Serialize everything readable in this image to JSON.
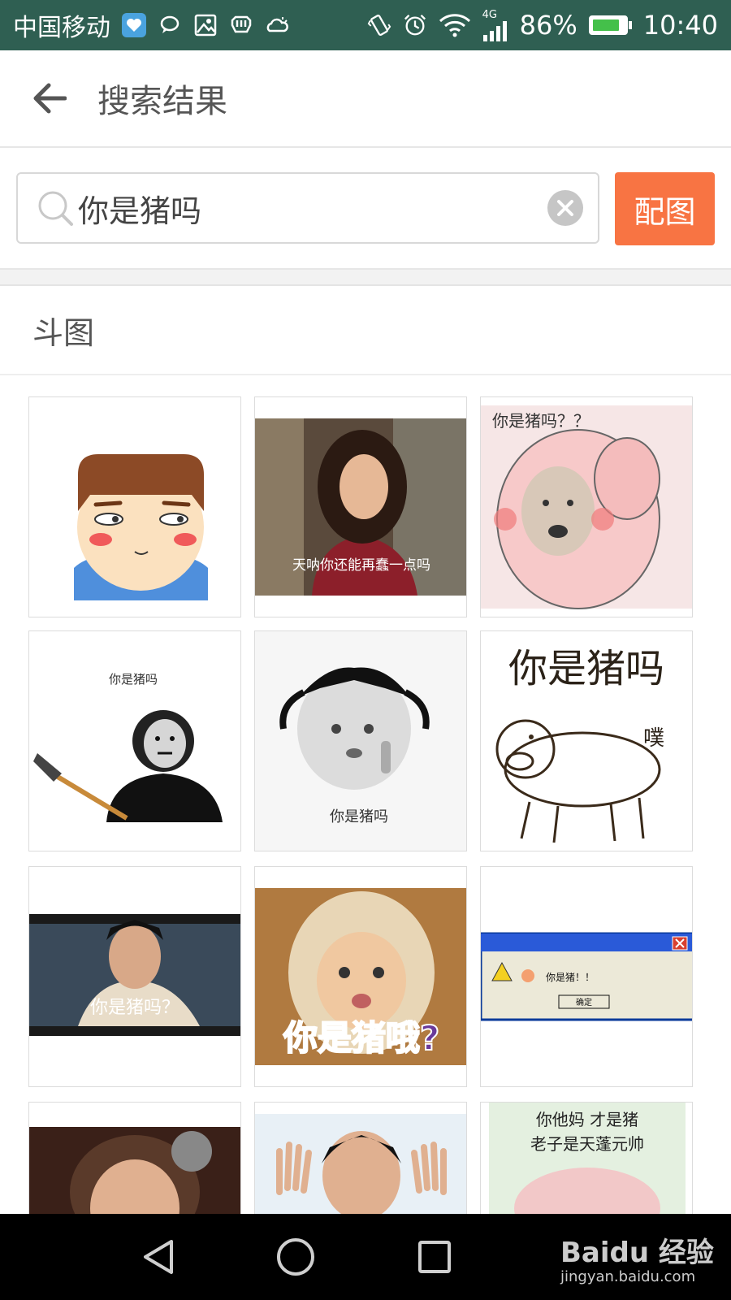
{
  "status_bar": {
    "carrier": "中国移动",
    "network": "4G",
    "battery": "86%",
    "battery_level": 0.86,
    "time": "10:40"
  },
  "header": {
    "title": "搜索结果"
  },
  "search": {
    "query": "你是猪吗",
    "button_label": "配图"
  },
  "section": {
    "title": "斗图"
  },
  "results": {
    "captions": {
      "r1c2": "天呐你还能再蠢一点吗",
      "r1c3": "你是猪吗？？",
      "r2c1": "你是猪吗",
      "r2c2": "你是猪吗",
      "r2c3_title": "你是猪吗",
      "r2c3_sfx": "噗",
      "r3c1": "你是猪吗？",
      "r3c2": "你是猪哦?",
      "r3c3_msg": "你是猪！！",
      "r3c3_ok": "确定",
      "r4c3_line1": "你他妈 才是猪",
      "r4c3_line2": "老子是天蓬元帅"
    }
  },
  "watermark": {
    "brand": "Baidu 经验",
    "site": "jingyan.baidu.com"
  }
}
